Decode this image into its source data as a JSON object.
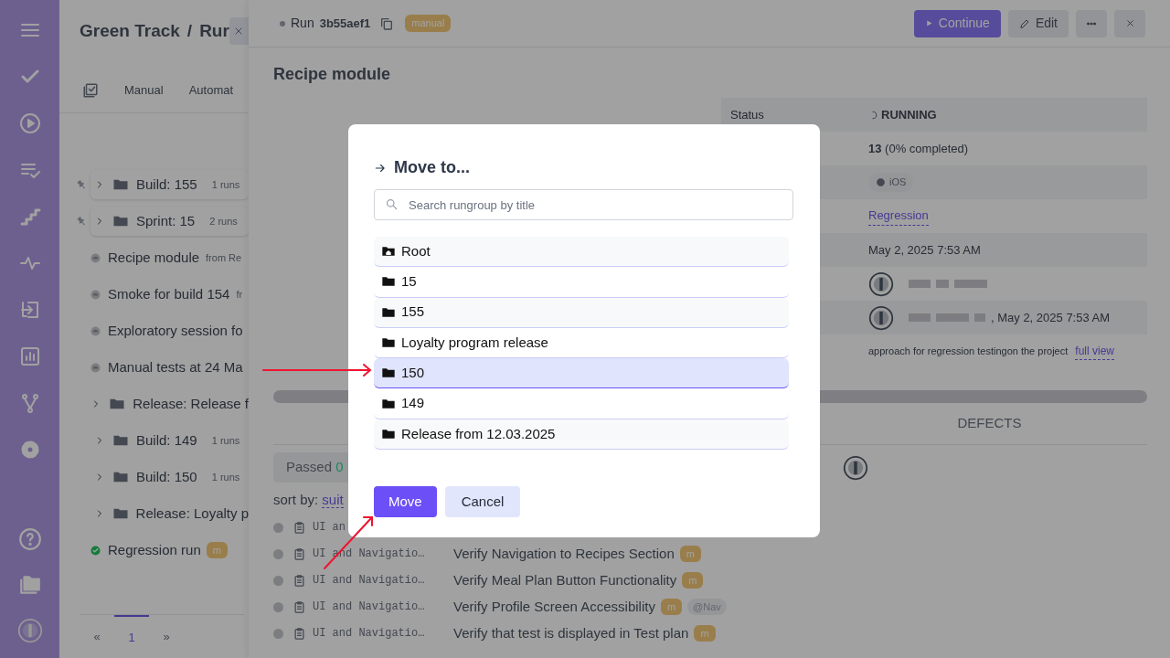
{
  "left_panel": {
    "breadcrumb": {
      "project": "Green Track",
      "separator": "/",
      "page": "Rur"
    },
    "tabs": [
      {
        "label": "Manual",
        "selected": false
      },
      {
        "label": "Automat",
        "selected": false
      }
    ],
    "items": [
      {
        "kind": "group",
        "title": "Build: 155",
        "count": "1 runs",
        "pinned": true
      },
      {
        "kind": "group",
        "title": "Sprint: 15",
        "count": "2 runs",
        "pinned": true
      },
      {
        "kind": "run",
        "title": "Recipe module",
        "source": "from Re",
        "passed": false
      },
      {
        "kind": "run",
        "title": "Smoke for build 154",
        "source": "fr",
        "passed": false
      },
      {
        "kind": "run",
        "title": "Exploratory session fo",
        "passed": false
      },
      {
        "kind": "run",
        "title": "Manual tests at 24 Ma",
        "passed": false
      },
      {
        "kind": "group",
        "title": "Release: Release f",
        "pinned": false
      },
      {
        "kind": "group",
        "title": "Build: 149",
        "count": "1 runs",
        "pinned": false
      },
      {
        "kind": "group",
        "title": "Build: 150",
        "count": "1 runs",
        "pinned": false
      },
      {
        "kind": "group",
        "title": "Release: Loyalty p",
        "pinned": false
      },
      {
        "kind": "run",
        "title": "Regression run",
        "badge": "m",
        "passed": true
      }
    ],
    "pagination": {
      "prev": "«",
      "pages": [
        {
          "label": "1",
          "selected": true
        }
      ],
      "next": "»"
    }
  },
  "run": {
    "label": "Run",
    "id": "3b55aef1",
    "badge": "manual",
    "buttons": [
      {
        "kind": "continue",
        "label": "Continue"
      },
      {
        "kind": "edit",
        "label": "Edit"
      },
      {
        "kind": "more"
      },
      {
        "kind": "close"
      }
    ],
    "title": "Recipe module",
    "details": {
      "status_label": "Status",
      "status": "RUNNING",
      "tests": "13",
      "tests_note": "(0% completed)",
      "tag": "iOS",
      "plan": "Regression",
      "created": "May 2, 2025 7:53 AM",
      "finished": ", May 2, 2025 7:53 AM",
      "description": "approach for regression testingon the project",
      "description_link": "full view"
    },
    "progress": {
      "level": 0
    },
    "tabs": [
      {
        "label": "DEFECTS",
        "selected": false
      }
    ],
    "filter": {
      "label": "Passed",
      "count": "0"
    },
    "sort": {
      "label": "sort by:",
      "value": "suit"
    },
    "tests": [
      {
        "suite": "UI an"
      },
      {
        "suite": "UI and Navigatio…",
        "title": "Verify Navigation to Recipes Section",
        "badge": "m"
      },
      {
        "suite": "UI and Navigatio…",
        "title": "Verify Meal Plan Button Functionality",
        "badge": "m"
      },
      {
        "suite": "UI and Navigatio…",
        "title": "Verify Profile Screen Accessibility",
        "badge": "m",
        "tag": "@Nav"
      },
      {
        "suite": "UI and Navigatio…",
        "title": "Verify that test is displayed in Test plan",
        "badge": "m"
      }
    ]
  },
  "modal": {
    "title": "Move to...",
    "search_placeholder": "Search rungroup by title",
    "options": [
      {
        "kind": "root",
        "label": "Root",
        "selected": false
      },
      {
        "kind": "folder",
        "label": "15",
        "selected": false
      },
      {
        "kind": "folder",
        "label": "155",
        "selected": false
      },
      {
        "kind": "folder",
        "label": "Loyalty program release",
        "selected": false
      },
      {
        "kind": "folder",
        "label": "150",
        "selected": true
      },
      {
        "kind": "folder",
        "label": "149",
        "selected": false
      },
      {
        "kind": "folder",
        "label": "Release from 12.03.2025",
        "selected": false
      }
    ],
    "buttons": [
      {
        "kind": "primary",
        "label": "Move"
      },
      {
        "kind": "secondary",
        "label": "Cancel"
      }
    ]
  }
}
